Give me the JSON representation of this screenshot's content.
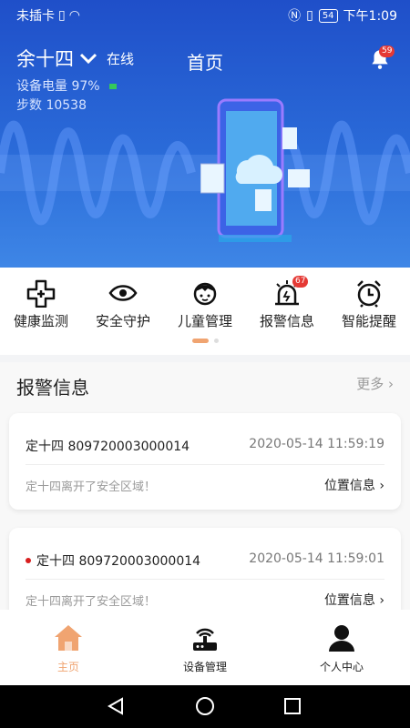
{
  "status_bar": {
    "carrier": "未插卡",
    "battery": "54",
    "time": "下午1:09"
  },
  "header": {
    "user_name": "余十四",
    "user_status": "在线",
    "title": "首页",
    "notification_count": "59",
    "battery_line": "设备电量 97%",
    "steps_line": "步数 10538"
  },
  "functions": [
    {
      "label": "健康监测",
      "icon": "medical-cross-icon"
    },
    {
      "label": "安全守护",
      "icon": "eye-icon"
    },
    {
      "label": "儿童管理",
      "icon": "child-face-icon"
    },
    {
      "label": "报警信息",
      "icon": "alarm-light-icon",
      "badge": "67"
    },
    {
      "label": "智能提醒",
      "icon": "alarm-clock-icon"
    }
  ],
  "carousel": {
    "pages": 2,
    "active": 0
  },
  "alarms": {
    "title": "报警信息",
    "more_label": "更多",
    "items": [
      {
        "device": "定十四 809720003000014",
        "time": "2020-05-14 11:59:19",
        "message": "定十四离开了安全区域！",
        "action": "位置信息",
        "unread": false
      },
      {
        "device": "定十四 809720003000014",
        "time": "2020-05-14 11:59:01",
        "message": "定十四离开了安全区域！",
        "action": "位置信息",
        "unread": true
      }
    ]
  },
  "tabbar": [
    {
      "label": "主页",
      "icon": "home-icon",
      "active": true
    },
    {
      "label": "设备管理",
      "icon": "router-icon",
      "active": false
    },
    {
      "label": "个人中心",
      "icon": "person-icon",
      "active": false
    }
  ],
  "colors": {
    "accent": "#f0a471",
    "header_blue": "#2a6ad8",
    "badge_red": "#e53935"
  }
}
